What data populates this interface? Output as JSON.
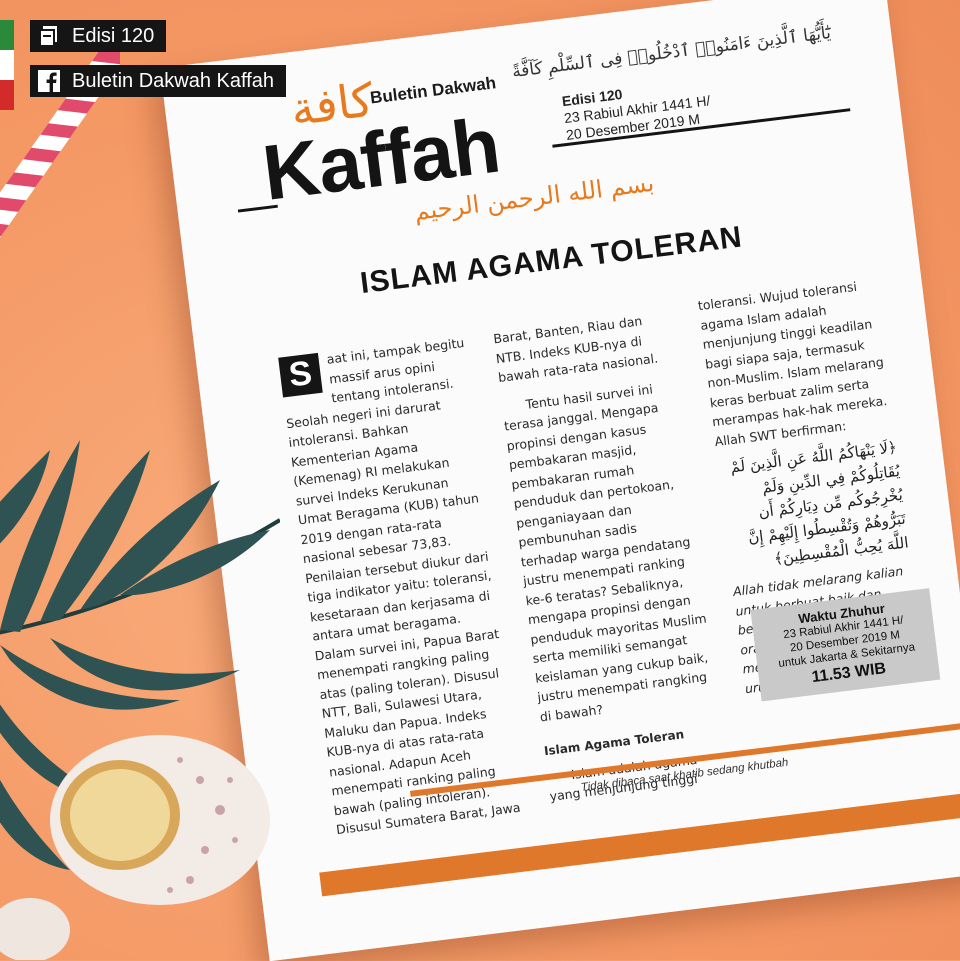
{
  "tags": {
    "edisi": "Edisi 120",
    "page": "Buletin Dakwah Kaffah",
    "edisi_icon": "document-icon",
    "page_icon": "facebook-icon"
  },
  "header": {
    "ayat_top": "يَٰٓأَيُّهَا ٱلَّذِينَ ءَامَنُوا۟ ٱدْخُلُوا۟ فِى ٱلسِّلْمِ كَآفَّةً",
    "logo_arabic": "كافة",
    "logo_sub": "Buletin Dakwah",
    "logo_main": "Kaffah",
    "edisi": "Edisi 120",
    "date_hijri": "23 Rabiul Akhir 1441 H/",
    "date_masehi": "20 Desember 2019 M",
    "basmalah": "بسم الله الرحمن الرحيم"
  },
  "article": {
    "title": "ISLAM AGAMA TOLERAN",
    "dropcap": "S",
    "col1": "aat ini, tampak begitu massif arus opini tentang intoleransi. Seolah negeri ini darurat intoleransi. Bahkan Kementerian Agama (Kemenag) RI melakukan survei Indeks Kerukunan Umat Beragama (KUB) tahun 2019 dengan rata-rata nasional sebesar 73,83. Penilaian tersebut diukur dari tiga indikator yaitu: toleransi, kesetaraan dan kerjasama di antara umat beragama. Dalam survei ini, Papua Barat menempati rangking paling atas (paling toleran). Disusul NTT, Bali, Sulawesi Utara, Maluku dan Papua. Indeks KUB-nya di atas rata-rata nasional. Adapun Aceh menempati ranking paling bawah (paling intoleran). Disusul Sumatera Barat, Jawa",
    "col2_a": "Barat, Banten, Riau dan NTB. Indeks KUB-nya di bawah rata-rata nasional.",
    "col2_b": "Tentu hasil survei ini terasa janggal. Mengapa propinsi dengan kasus pembakaran masjid, pembakaran rumah penduduk dan pertokoan, penganiayaan dan pembunuhan sadis terhadap warga pendatang justru menempati ranking ke-6 teratas? Sebaliknya, mengapa propinsi dengan penduduk mayoritas Muslim serta memiliki semangat keislaman yang cukup baik, justru menempati rangking di bawah?",
    "subheading": "Islam Agama Toleran",
    "col2_c": "Islam adalah agama yang menjunjung tinggi",
    "col3_a": "toleransi. Wujud toleransi agama Islam adalah menjunjung tinggi keadilan bagi siapa saja, termasuk non-Muslim. Islam melarang keras berbuat zalim serta merampas hak-hak mereka. Allah SWT berfirman:",
    "col3_arabic": "﴿لَا يَنْهَاكُمُ اللَّهُ عَنِ الَّذِينَ لَمْ يُقَاتِلُوكُمْ فِي الدِّينِ وَلَمْ يُخْرِجُوكُم مِّن دِيَارِكُمْ أَن تَبَرُّوهُمْ وَتُقْسِطُوا إِلَيْهِمْ إِنَّ اللَّهَ يُحِبُّ الْمُقْسِطِينَ﴾",
    "col3_b": "Allah tidak melarang kalian untuk berbuat baik dan berlaku adil terhadap orang-orang yang tidak memerangi kalian dalam urusan agama"
  },
  "zhuhur": {
    "heading": "Waktu Zhuhur",
    "line1": "23 Rabiul Akhir 1441 H/",
    "line2": "20 Desember 2019 M",
    "line3": "untuk Jakarta & Sekitarnya",
    "time": "11.53 WIB"
  },
  "footer": {
    "note": "Tidak dibaca saat khatib sedang khutbah"
  },
  "colors": {
    "background": "#f6a06c",
    "accent": "#e0782b",
    "ink": "#141414"
  }
}
